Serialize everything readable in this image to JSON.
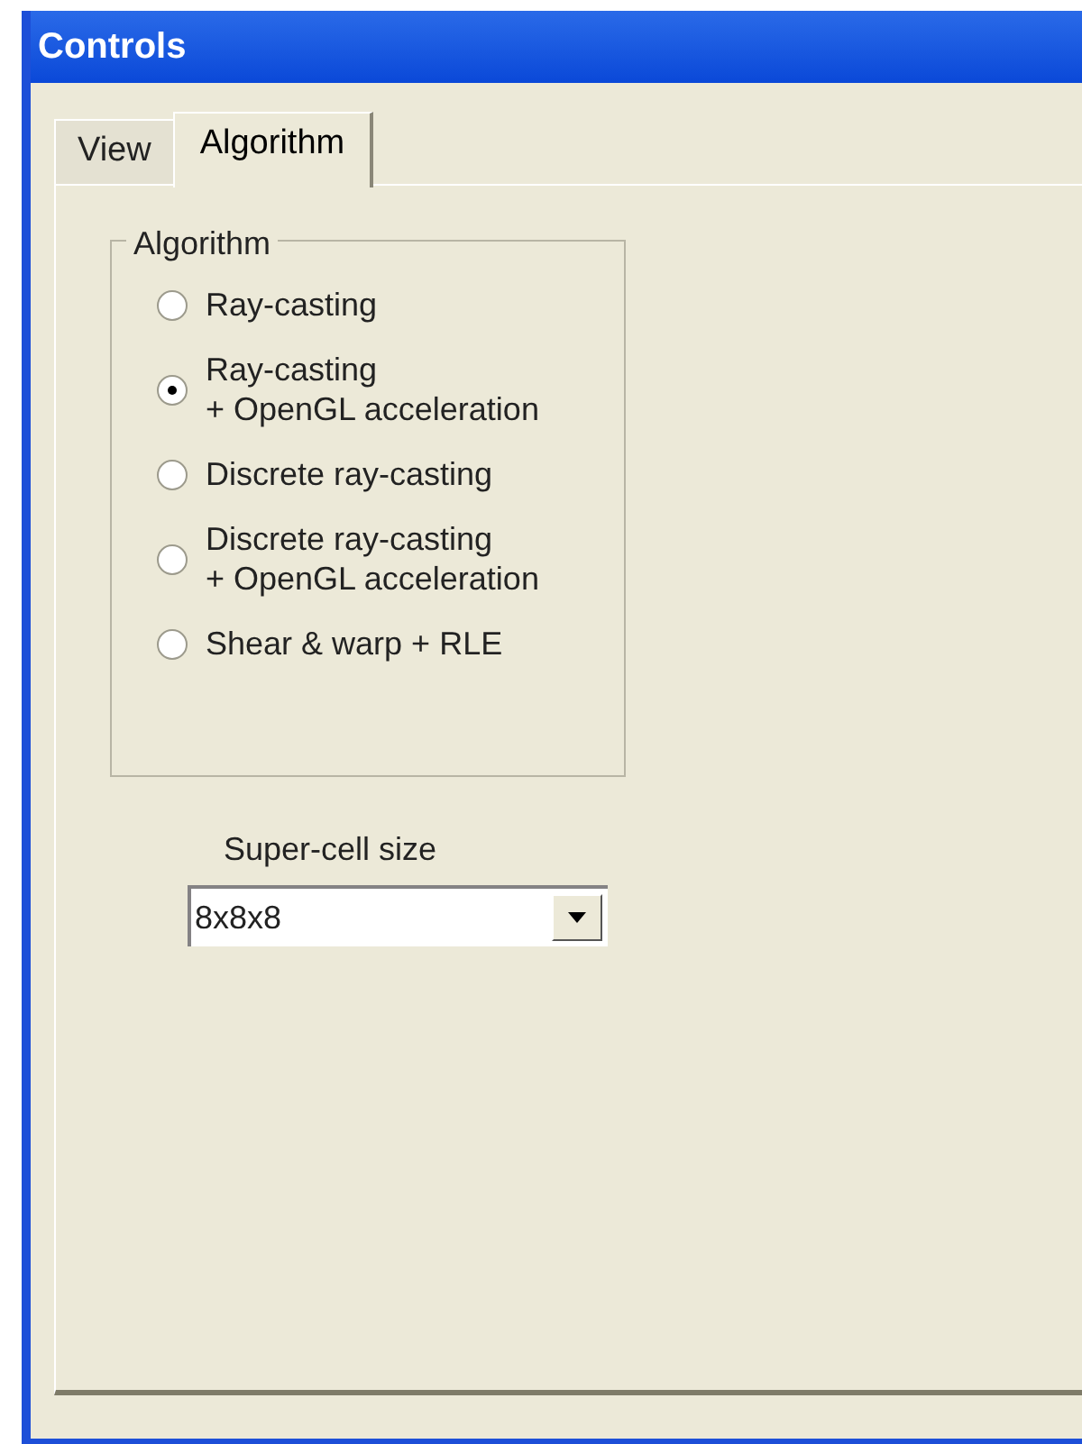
{
  "window": {
    "title": "Controls"
  },
  "tabs": [
    {
      "label": "View",
      "selected": false
    },
    {
      "label": "Algorithm",
      "selected": true
    }
  ],
  "algorithm_group": {
    "title": "Algorithm",
    "options": [
      {
        "label": "Ray-casting",
        "selected": false
      },
      {
        "label": "Ray-casting\n+ OpenGL acceleration",
        "selected": true
      },
      {
        "label": "Discrete ray-casting",
        "selected": false
      },
      {
        "label": "Discrete ray-casting\n+ OpenGL acceleration",
        "selected": false
      },
      {
        "label": "Shear & warp + RLE",
        "selected": false
      }
    ]
  },
  "super_cell_size": {
    "label": "Super-cell size",
    "value": "8x8x8"
  }
}
